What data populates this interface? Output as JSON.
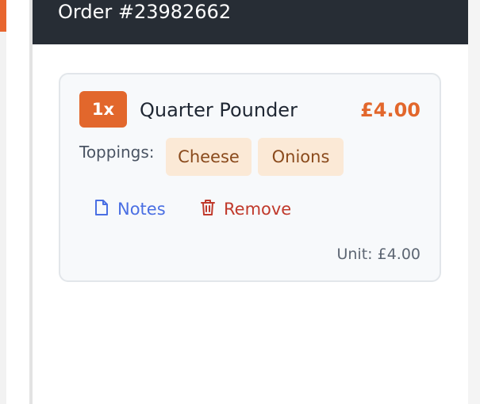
{
  "header": {
    "title": "Order #23982662"
  },
  "item": {
    "quantity": "1x",
    "name": "Quarter Pounder",
    "price": "£4.00",
    "toppings_label": "Toppings:",
    "toppings": [
      "Cheese",
      "Onions"
    ],
    "unit_price": "Unit: £4.00"
  },
  "actions": {
    "notes_label": "Notes",
    "remove_label": "Remove"
  },
  "colors": {
    "accent": "#e2672c",
    "header_bg": "#272d35",
    "notes": "#4a6fe3",
    "remove": "#c0392b",
    "chip_bg": "#fbe9d6"
  },
  "icons": {
    "notes": "document-icon",
    "remove": "trash-icon"
  }
}
